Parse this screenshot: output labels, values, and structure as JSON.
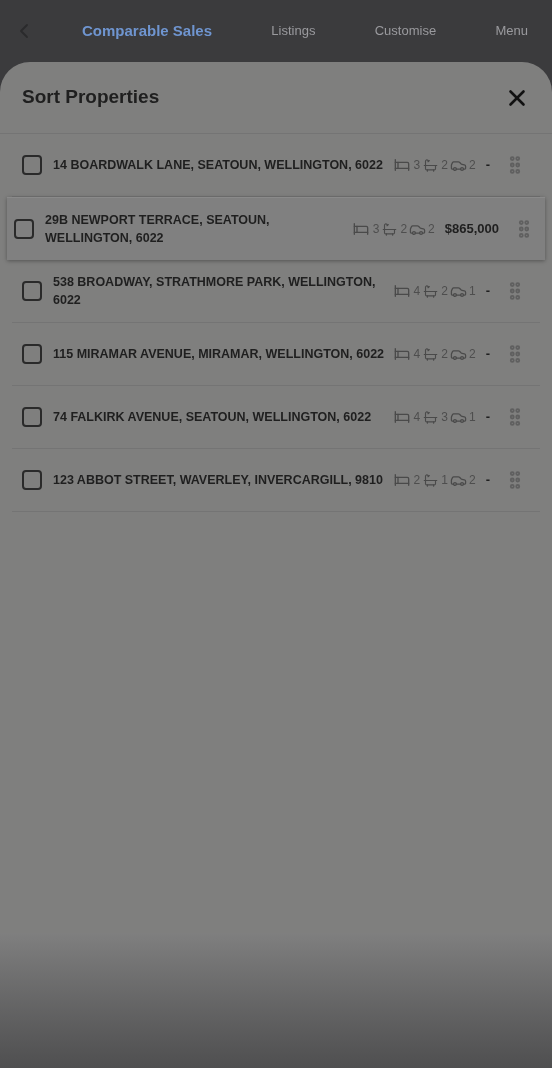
{
  "top_bar": {
    "tabs": [
      {
        "label": "Comparable Sales",
        "selected": true
      },
      {
        "label": "Listings",
        "selected": false
      },
      {
        "label": "Customise",
        "selected": false
      },
      {
        "label": "Menu",
        "selected": false
      }
    ]
  },
  "sheet": {
    "title": "Sort Properties",
    "properties": [
      {
        "address": "14 BOARDWALK LANE, SEATOUN, WELLINGTON, 6022",
        "beds": "3",
        "baths": "2",
        "cars": "2",
        "price": "-",
        "checked": false,
        "dragging": false
      },
      {
        "address": "29B NEWPORT TERRACE, SEATOUN, WELLINGTON, 6022",
        "beds": "3",
        "baths": "2",
        "cars": "2",
        "price": "$865,000",
        "checked": false,
        "dragging": true
      },
      {
        "address": "538 BROADWAY, STRATHMORE PARK, WELLINGTON, 6022",
        "beds": "4",
        "baths": "2",
        "cars": "1",
        "price": "-",
        "checked": false,
        "dragging": false
      },
      {
        "address": "115 MIRAMAR AVENUE, MIRAMAR, WELLINGTON, 6022",
        "beds": "4",
        "baths": "2",
        "cars": "2",
        "price": "-",
        "checked": false,
        "dragging": false
      },
      {
        "address": "74 FALKIRK AVENUE, SEATOUN, WELLINGTON, 6022",
        "beds": "4",
        "baths": "3",
        "cars": "1",
        "price": "-",
        "checked": false,
        "dragging": false
      },
      {
        "address": "123 ABBOT STREET, WAVERLEY, INVERCARGILL, 9810",
        "beds": "2",
        "baths": "1",
        "cars": "2",
        "price": "-",
        "checked": false,
        "dragging": false
      }
    ]
  }
}
